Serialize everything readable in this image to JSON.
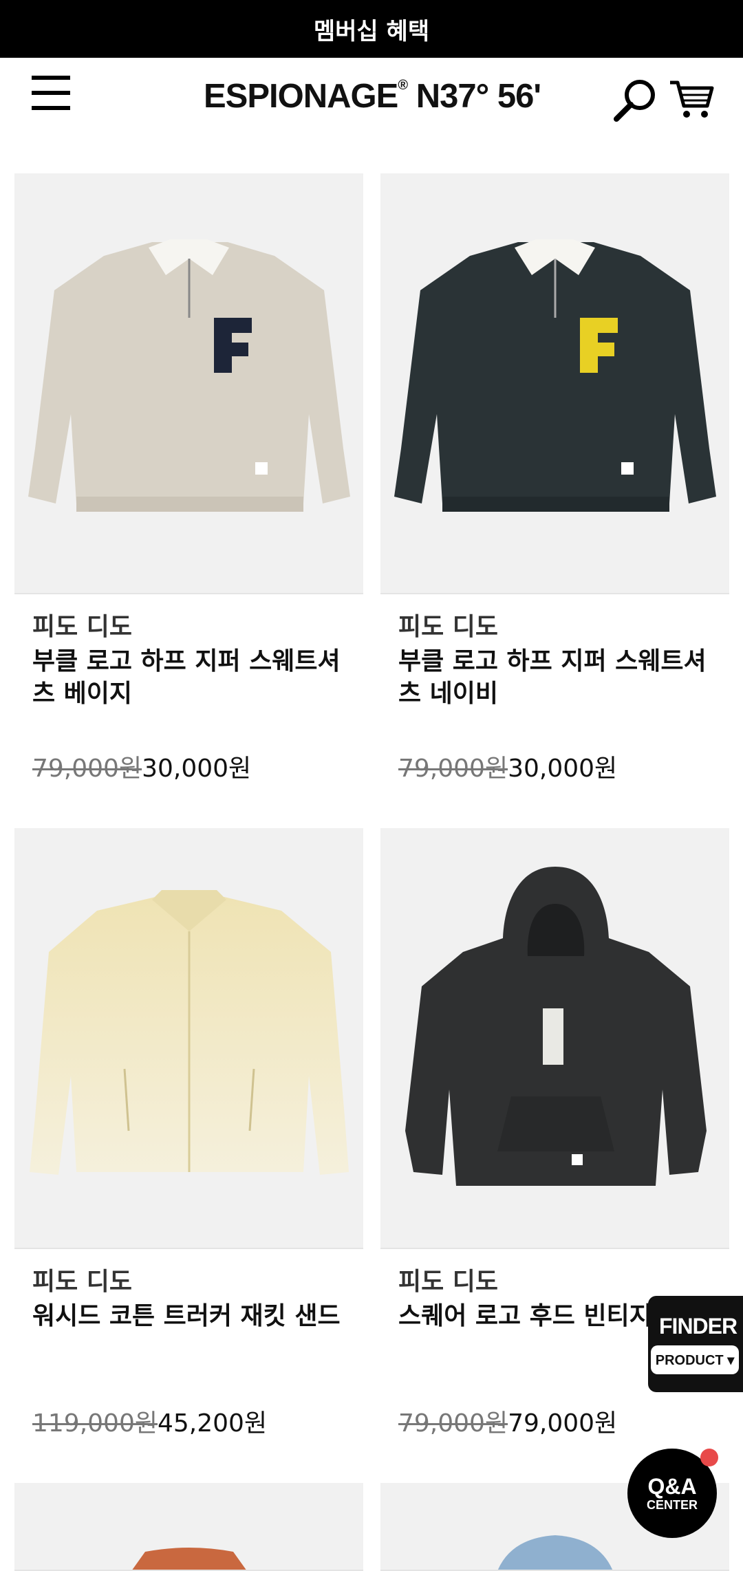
{
  "banner": {
    "text": "멤버십 혜택"
  },
  "header": {
    "logo_text": "ESPIONAGE",
    "logo_mark": "®",
    "logo_coords": "N37° 56'",
    "icons": [
      "menu-icon",
      "search-icon",
      "cart-icon"
    ]
  },
  "products": [
    {
      "brand": "피도 디도",
      "name": "부클 로고 하프 지퍼 스웨트셔츠 베이지",
      "old_price": "79,000원",
      "price": "30,000원",
      "color": "#d8d2c6"
    },
    {
      "brand": "피도 디도",
      "name": "부클 로고 하프 지퍼 스웨트셔츠 네이비",
      "old_price": "79,000원",
      "price": "30,000원",
      "color": "#2a3336"
    },
    {
      "brand": "피도 디도",
      "name": "워시드 코튼 트러커 재킷 샌드",
      "old_price": "119,000원",
      "price": "45,200원",
      "color": "#efe6c2"
    },
    {
      "brand": "피도 디도",
      "name": "스퀘어 로고 후드 빈티지",
      "old_price": "79,000원",
      "price": "79,000원",
      "color": "#2f3031"
    }
  ],
  "floating": {
    "finder_title": "FINDER",
    "finder_sub": "PRODUCT ▾",
    "qa_title": "Q&A",
    "qa_sub": "CENTER"
  },
  "colors": {
    "banner_bg": "#000000",
    "badge_dot": "#e84a4a",
    "placeholder_bg": "#f1f1f1"
  }
}
